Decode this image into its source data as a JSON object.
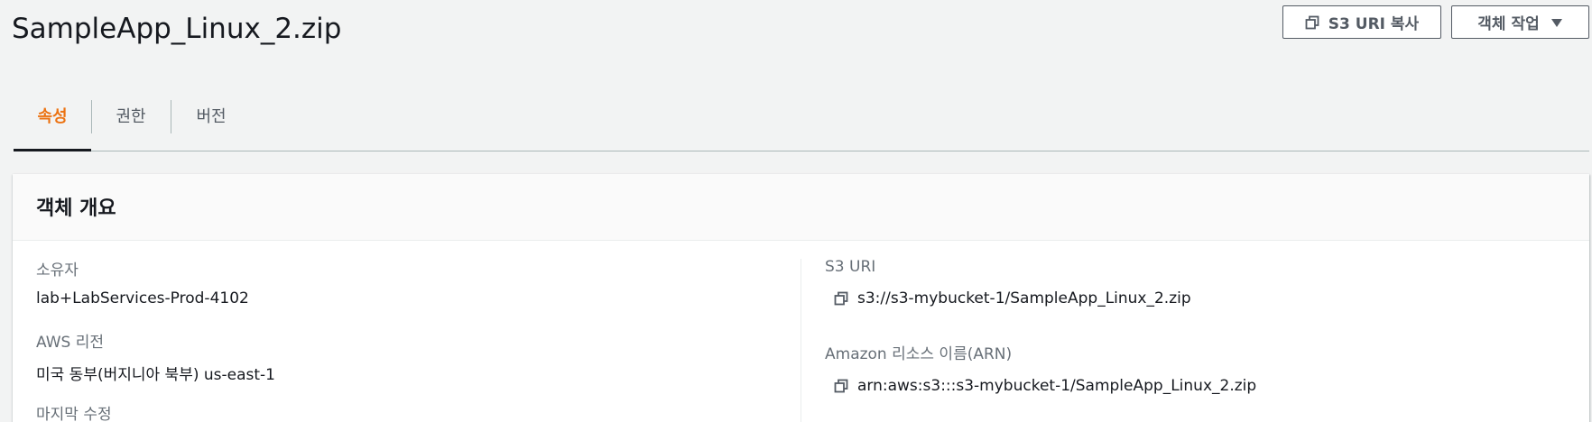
{
  "header": {
    "title": "SampleApp_Linux_2.zip",
    "copy_uri_button": "S3 URI 복사",
    "actions_button": "객체 작업"
  },
  "tabs": [
    {
      "label": "속성",
      "active": true
    },
    {
      "label": "권한",
      "active": false
    },
    {
      "label": "버전",
      "active": false
    }
  ],
  "overview": {
    "title": "객체 개요",
    "owner": {
      "label": "소유자",
      "value": "lab+LabServices-Prod-4102"
    },
    "region": {
      "label": "AWS 리전",
      "value": "미국 동부(버지니아 북부) us-east-1"
    },
    "last_modified": {
      "label": "마지막 수정"
    },
    "s3_uri": {
      "label": "S3 URI",
      "value": "s3://s3-mybucket-1/SampleApp_Linux_2.zip"
    },
    "arn": {
      "label": "Amazon 리소스 이름(ARN)",
      "value": "arn:aws:s3:::s3-mybucket-1/SampleApp_Linux_2.zip"
    }
  },
  "colors": {
    "accent_tab": "#ec7211",
    "text": "#16191f",
    "label": "#687078",
    "button_border": "#545b64"
  },
  "icons": [
    "copy-icon",
    "caret-down-icon"
  ]
}
